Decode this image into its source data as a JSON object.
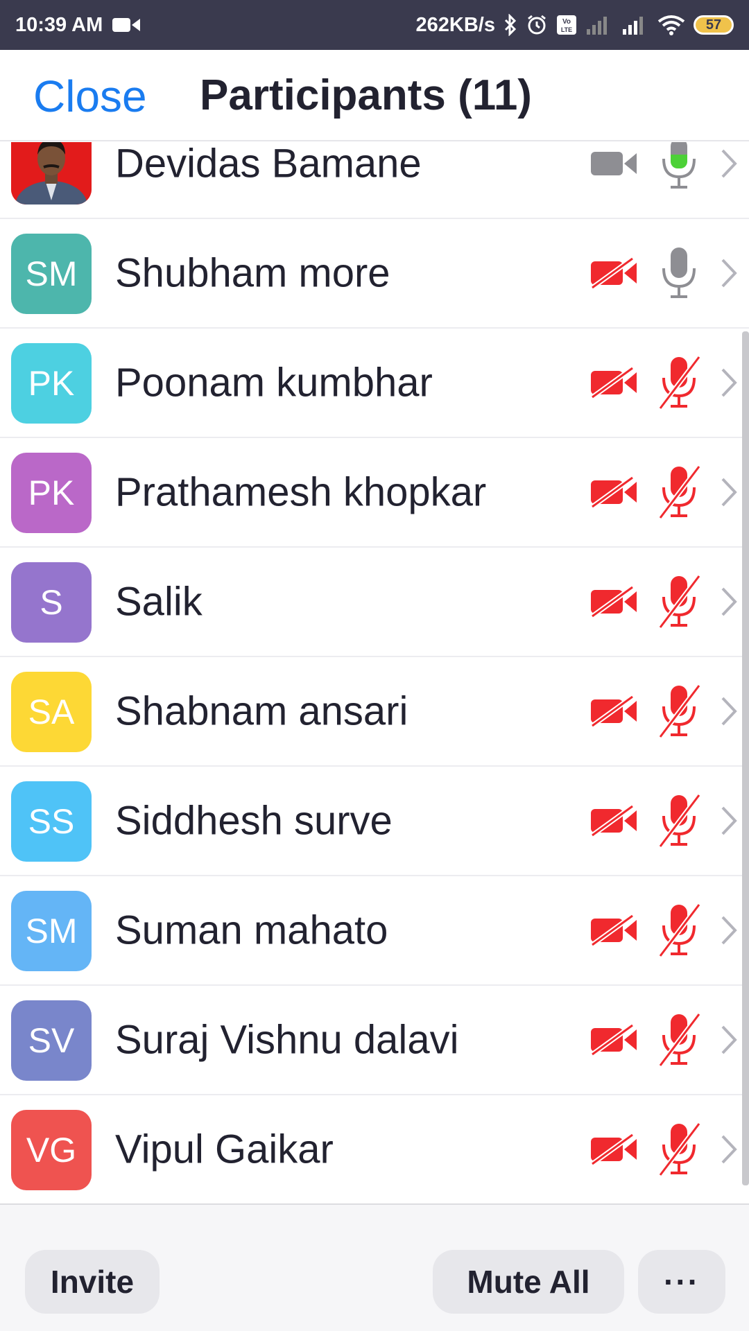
{
  "status_bar": {
    "time": "10:39 AM",
    "net_speed": "262KB/s",
    "battery": "57"
  },
  "header": {
    "close_label": "Close",
    "title": "Participants (11)"
  },
  "participants": [
    {
      "name": "Devidas Bamane",
      "initials": "",
      "avatar_color": "#e21b1b",
      "photo": true,
      "video": "on",
      "audio": "speaking"
    },
    {
      "name": "Shubham more",
      "initials": "SM",
      "avatar_color": "#4db6ac",
      "photo": false,
      "video": "off",
      "audio": "unmuted"
    },
    {
      "name": "Poonam kumbhar",
      "initials": "PK",
      "avatar_color": "#4dd0e1",
      "photo": false,
      "video": "off",
      "audio": "muted"
    },
    {
      "name": "Prathamesh khopkar",
      "initials": "PK",
      "avatar_color": "#ba68c8",
      "photo": false,
      "video": "off",
      "audio": "muted"
    },
    {
      "name": "Salik",
      "initials": "S",
      "avatar_color": "#9575cd",
      "photo": false,
      "video": "off",
      "audio": "muted"
    },
    {
      "name": "Shabnam ansari",
      "initials": "SA",
      "avatar_color": "#fdd835",
      "photo": false,
      "video": "off",
      "audio": "muted"
    },
    {
      "name": "Siddhesh surve",
      "initials": "SS",
      "avatar_color": "#4fc3f7",
      "photo": false,
      "video": "off",
      "audio": "muted"
    },
    {
      "name": "Suman mahato",
      "initials": "SM",
      "avatar_color": "#64b5f6",
      "photo": false,
      "video": "off",
      "audio": "muted"
    },
    {
      "name": "Suraj Vishnu dalavi",
      "initials": "SV",
      "avatar_color": "#7986cb",
      "photo": false,
      "video": "off",
      "audio": "muted"
    },
    {
      "name": "Vipul Gaikar",
      "initials": "VG",
      "avatar_color": "#ef5350",
      "photo": false,
      "video": "off",
      "audio": "muted"
    }
  ],
  "bottom_bar": {
    "invite_label": "Invite",
    "mute_all_label": "Mute All",
    "more_label": "···"
  },
  "colors": {
    "accent_blue": "#1a7cf0",
    "muted_red": "#f0292e",
    "speaking_green": "#4cd137",
    "icon_gray": "#8e8e93"
  }
}
